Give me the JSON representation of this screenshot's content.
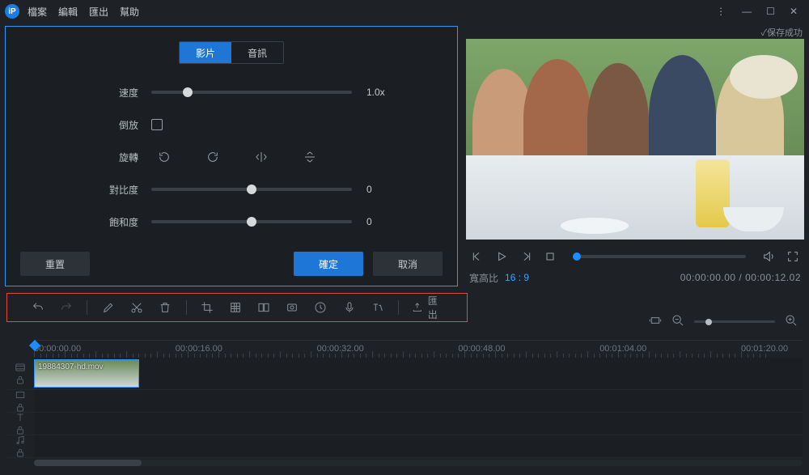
{
  "menu": {
    "file": "檔案",
    "edit": "編輯",
    "export": "匯出",
    "help": "幫助"
  },
  "panel": {
    "tab_video": "影片",
    "tab_audio": "音訊",
    "speed_label": "速度",
    "speed_value": "1.0x",
    "reverse_label": "倒放",
    "rotate_label": "旋轉",
    "contrast_label": "對比度",
    "contrast_value": "0",
    "saturation_label": "飽和度",
    "saturation_value": "0",
    "reset": "重置",
    "ok": "確定",
    "cancel": "取消"
  },
  "preview": {
    "save_status": "✓保存成功",
    "aspect_label": "寬高比",
    "aspect_value": "16 : 9",
    "time": "00:00:00.00 / 00:00:12.02"
  },
  "toolbar": {
    "export": "匯出"
  },
  "timeline": {
    "marks": [
      "00:00:00.00",
      "00:00:16.00",
      "00:00:32.00",
      "00:00:48.00",
      "00:01:04.00",
      "00:01:20.00"
    ],
    "clip_name": "19884307-hd.mov"
  }
}
